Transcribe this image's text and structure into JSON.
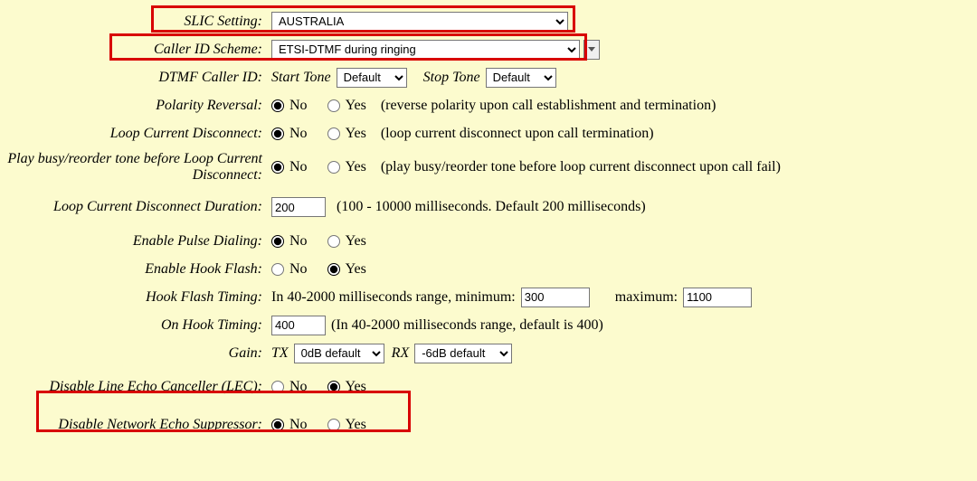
{
  "labels": {
    "slic_setting": "SLIC Setting:",
    "caller_id_scheme": "Caller ID Scheme:",
    "dtmf_caller_id": "DTMF Caller ID:",
    "polarity_reversal": "Polarity Reversal:",
    "loop_current_disconnect": "Loop Current Disconnect:",
    "play_busy_before": "Play busy/reorder tone before Loop Current Disconnect:",
    "loop_current_duration": "Loop Current Disconnect Duration:",
    "enable_pulse_dialing": "Enable Pulse Dialing:",
    "enable_hook_flash": "Enable Hook Flash:",
    "hook_flash_timing": "Hook Flash Timing:",
    "on_hook_timing": "On Hook Timing:",
    "gain": "Gain:",
    "disable_lec": "Disable Line Echo Canceller (LEC):",
    "disable_nes": "Disable Network Echo Suppressor:"
  },
  "radios": {
    "no": "No",
    "yes": "Yes"
  },
  "values": {
    "slic_setting": "AUSTRALIA",
    "caller_id_scheme": "ETSI-DTMF during ringing",
    "dtmf_start_tone": "Default",
    "dtmf_stop_tone": "Default",
    "loop_current_duration": "200",
    "hook_flash_min": "300",
    "hook_flash_max": "1100",
    "on_hook": "400",
    "gain_tx": "0dB default",
    "gain_rx": "-6dB default"
  },
  "inline": {
    "start_tone": "Start Tone",
    "stop_tone": "Stop Tone",
    "hook_flash_prefix": "In 40-2000 milliseconds range, minimum:",
    "hook_flash_max_label": "maximum:",
    "on_hook_hint": "(In 40-2000 milliseconds range, default is 400)",
    "tx": "TX",
    "rx": "RX"
  },
  "hints": {
    "polarity": "(reverse polarity upon call establishment and termination)",
    "loop_disconnect": "(loop current disconnect upon call termination)",
    "play_busy": "(play busy/reorder tone before loop current disconnect upon call fail)",
    "loop_duration": "(100 - 10000 milliseconds. Default 200 milliseconds)"
  },
  "selected": {
    "polarity_reversal": "no",
    "loop_current_disconnect": "no",
    "play_busy_before": "no",
    "enable_pulse_dialing": "no",
    "enable_hook_flash": "yes",
    "disable_lec": "yes",
    "disable_nes": "no"
  }
}
